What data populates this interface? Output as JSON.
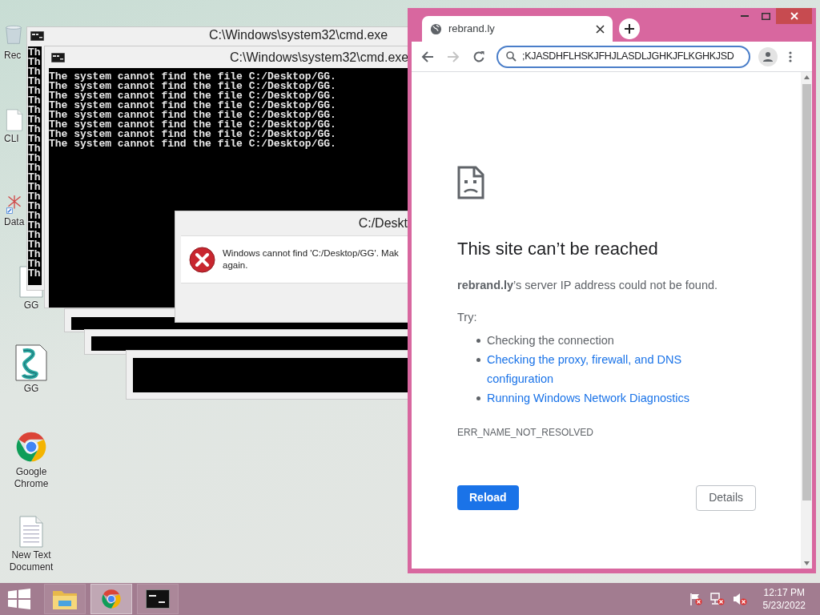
{
  "desktop": {
    "icons": [
      {
        "label": "Rec",
        "kind": "recycle-bin"
      },
      {
        "label": "CLI",
        "kind": "document"
      },
      {
        "label": "Data",
        "kind": "shortcut"
      },
      {
        "label": "GG",
        "kind": "document"
      },
      {
        "label": "GG",
        "kind": "script"
      },
      {
        "label": "Google Chrome",
        "kind": "chrome"
      },
      {
        "label": "New Text Document",
        "kind": "text"
      }
    ]
  },
  "console_back": {
    "title": "C:\\Windows\\system32\\cmd.exe",
    "lines": [
      "Th",
      "Th",
      "Th",
      "Th",
      "Th",
      "Th",
      "Th",
      "Th",
      "Th",
      "Th",
      "Th",
      "Th",
      "Th",
      "Th",
      "Th",
      "Th",
      "Th",
      "Th",
      "Th",
      "Th",
      "Th",
      "Th",
      "Th",
      "Th"
    ]
  },
  "console_front": {
    "title": "C:\\Windows\\system32\\cmd.exe",
    "lines": [
      "The system cannot find the file C:/Desktop/GG.",
      "The system cannot find the file C:/Desktop/GG.",
      "The system cannot find the file C:/Desktop/GG.",
      "The system cannot find the file C:/Desktop/GG.",
      "The system cannot find the file C:/Desktop/GG.",
      "The system cannot find the file C:/Desktop/GG.",
      "The system cannot find the file C:/Desktop/GG.",
      "The system cannot find the file C:/Desktop/GG."
    ]
  },
  "dialog": {
    "title": "C:/Deskt",
    "message": [
      "Windows cannot find 'C:/Desktop/GG'. Mak",
      "again."
    ]
  },
  "browser": {
    "tab": {
      "title": "rebrand.ly",
      "selected": true
    },
    "forward": {
      "disabled": true
    },
    "address": ";KJASDHFLHSKJFHJLASDLJGHKJFLKGHKJSD",
    "page": {
      "heading": "This site can’t be reached",
      "message": "**rebrand.ly**’s server IP address could not be found.",
      "try_label": "Try:",
      "suggestions": [
        {
          "text": "Checking the connection",
          "kind": "text"
        },
        {
          "text": "Checking the proxy, firewall, and DNS configuration",
          "kind": "link"
        },
        {
          "text": "Running Windows Network Diagnostics",
          "kind": "link"
        }
      ],
      "error_code": "ERR_NAME_NOT_RESOLVED",
      "buttons": [
        {
          "label": "Reload",
          "kind": "primary"
        },
        {
          "label": "Details",
          "kind": "secondary"
        }
      ]
    }
  },
  "taskbar": {
    "apps": [
      {
        "kind": "folder",
        "selected": false
      },
      {
        "kind": "chrome",
        "selected": true
      },
      {
        "kind": "console",
        "selected": false
      }
    ],
    "time": "12:17 PM",
    "date": "5/23/2022"
  }
}
